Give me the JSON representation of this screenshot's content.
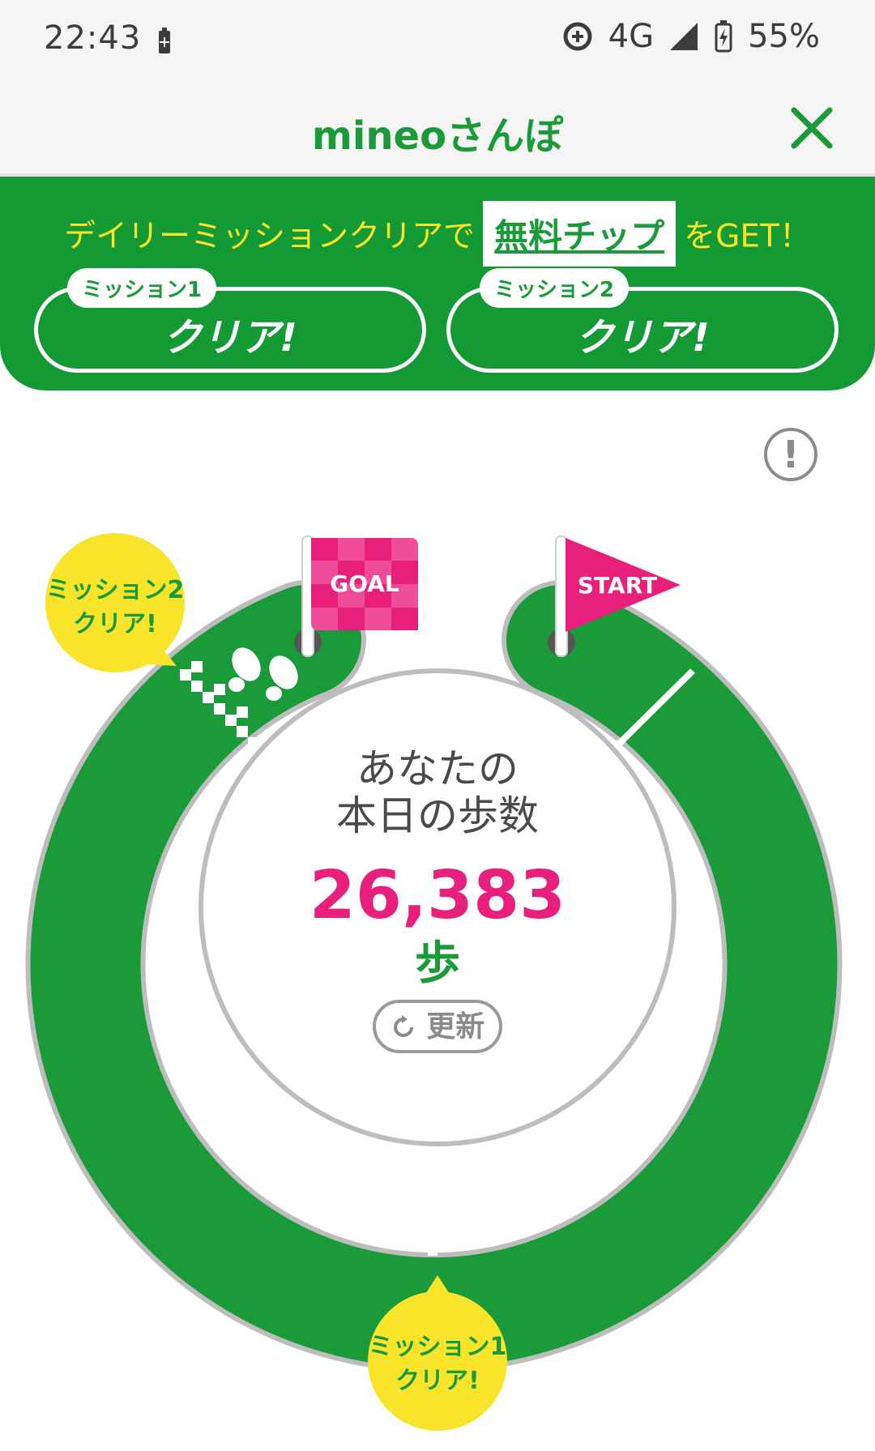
{
  "status_bar": {
    "time": "22:43",
    "network": "4G",
    "battery": "55%",
    "icons": [
      "battery-saver-icon",
      "data-saver-icon",
      "signal-icon",
      "battery-charging-icon"
    ]
  },
  "header": {
    "title": "mineoさんぽ",
    "close_icon": "close-icon"
  },
  "banner": {
    "prefix": "デイリーミッションクリアで",
    "highlight": "無料チップ",
    "suffix": "をGET！",
    "missions": [
      {
        "tag": "ミッション1",
        "status": "クリア!"
      },
      {
        "tag": "ミッション2",
        "status": "クリア!"
      }
    ]
  },
  "info_button": "!",
  "course": {
    "goal_label": "GOAL",
    "start_label": "START",
    "bubble_mission2_line1": "ミッション2",
    "bubble_mission2_line2": "クリア!",
    "bubble_mission1_line1": "ミッション1",
    "bubble_mission1_line2": "クリア!"
  },
  "steps": {
    "heading_line1": "あなたの",
    "heading_line2": "本日の歩数",
    "value": "26,383",
    "unit": "歩",
    "refresh_label": "更新"
  },
  "colors": {
    "green": "#139a34",
    "pink": "#e8207b",
    "yellow": "#f8e42a"
  }
}
